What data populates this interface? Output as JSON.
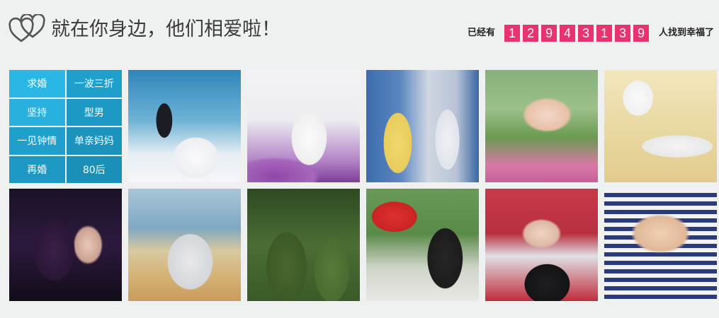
{
  "header": {
    "title": "就在你身边，他们相爱啦！",
    "count_prefix": "已经有",
    "count_digits": [
      "1",
      "2",
      "9",
      "4",
      "3",
      "1",
      "3",
      "9"
    ],
    "count_suffix": "人找到幸福了",
    "accent_color": "#e8336f",
    "icon": "double-heart-icon"
  },
  "tags": [
    {
      "label": "求婚"
    },
    {
      "label": "一波三折"
    },
    {
      "label": "坚持"
    },
    {
      "label": "型男"
    },
    {
      "label": "一见钟情"
    },
    {
      "label": "单亲妈妈"
    },
    {
      "label": "再婚"
    },
    {
      "label": "80后"
    }
  ],
  "tag_color": "#1f9fcc"
}
